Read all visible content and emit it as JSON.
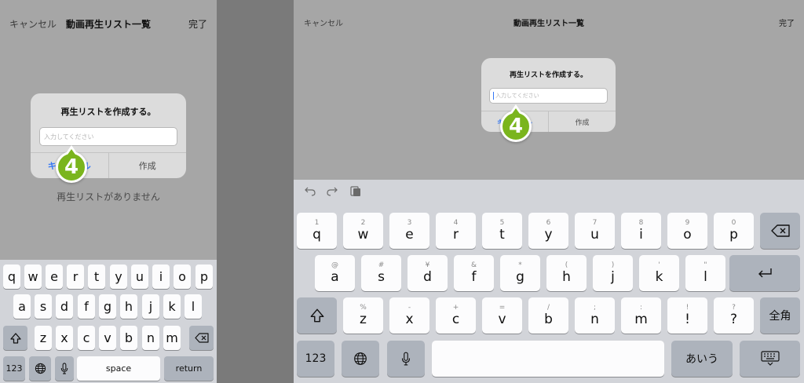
{
  "nav": {
    "cancel": "キャンセル",
    "title": "動画再生リスト一覧",
    "done": "完了"
  },
  "dialog": {
    "title": "再生リストを作成する。",
    "placeholder": "入力してください",
    "cancel": "キャンセル",
    "create": "作成"
  },
  "empty_text": "再生リストがありません",
  "marker_label": "4",
  "phone_keyboard": {
    "row1": [
      "q",
      "w",
      "e",
      "r",
      "t",
      "y",
      "u",
      "i",
      "o",
      "p"
    ],
    "row2": [
      "a",
      "s",
      "d",
      "f",
      "g",
      "h",
      "j",
      "k",
      "l"
    ],
    "row3": [
      "z",
      "x",
      "c",
      "v",
      "b",
      "n",
      "m"
    ],
    "numbers": "123",
    "space": "space",
    "return": "return"
  },
  "tablet_keyboard": {
    "row1_hints": [
      "1",
      "2",
      "3",
      "4",
      "5",
      "6",
      "7",
      "8",
      "9",
      "0"
    ],
    "row1": [
      "q",
      "w",
      "e",
      "r",
      "t",
      "y",
      "u",
      "i",
      "o",
      "p"
    ],
    "row2_hints": [
      "@",
      "#",
      "¥",
      "&",
      "*",
      "(",
      ")",
      "'",
      "\""
    ],
    "row2": [
      "a",
      "s",
      "d",
      "f",
      "g",
      "h",
      "j",
      "k",
      "l"
    ],
    "row3_hints": [
      "%",
      "-",
      "+",
      "=",
      "/",
      ";",
      ":",
      "!",
      "?"
    ],
    "row3": [
      "z",
      "x",
      "c",
      "v",
      "b",
      "n",
      "m",
      "!",
      "?"
    ],
    "row3_right": "全角",
    "numbers": "123",
    "kana": "あいう"
  },
  "icons": {
    "globe": "globe-icon",
    "mic": "microphone-icon",
    "shift": "shift-icon",
    "delete": "backspace-icon",
    "return": "return-icon",
    "undo": "undo-icon",
    "redo": "redo-icon",
    "paste": "paste-icon",
    "hide_keyboard": "keyboard-hide-icon"
  },
  "colors": {
    "accent": "#3478f6",
    "marker": "#7ab51d",
    "dim_background": "#a6a6a6"
  }
}
